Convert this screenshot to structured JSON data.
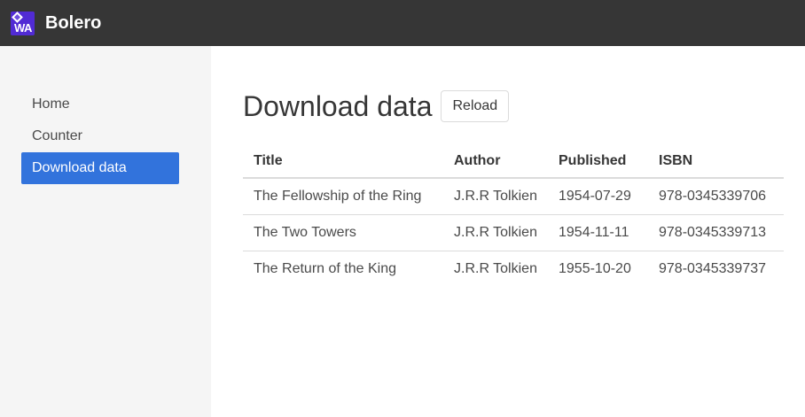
{
  "navbar": {
    "logo_text": "WA",
    "brand": "Bolero"
  },
  "sidebar": {
    "items": [
      {
        "label": "Home",
        "active": false
      },
      {
        "label": "Counter",
        "active": false
      },
      {
        "label": "Download data",
        "active": true
      }
    ]
  },
  "main": {
    "title": "Download data",
    "reload_label": "Reload",
    "table": {
      "headers": [
        "Title",
        "Author",
        "Published",
        "ISBN"
      ],
      "rows": [
        [
          "The Fellowship of the Ring",
          "J.R.R Tolkien",
          "1954-07-29",
          "978-0345339706"
        ],
        [
          "The Two Towers",
          "J.R.R Tolkien",
          "1954-11-11",
          "978-0345339713"
        ],
        [
          "The Return of the King",
          "J.R.R Tolkien",
          "1955-10-20",
          "978-0345339737"
        ]
      ]
    }
  },
  "colors": {
    "navbar_bg": "#363636",
    "sidebar_bg": "#f5f5f5",
    "active_item_bg": "#3273dc",
    "logo_bg": "#512bd4"
  }
}
